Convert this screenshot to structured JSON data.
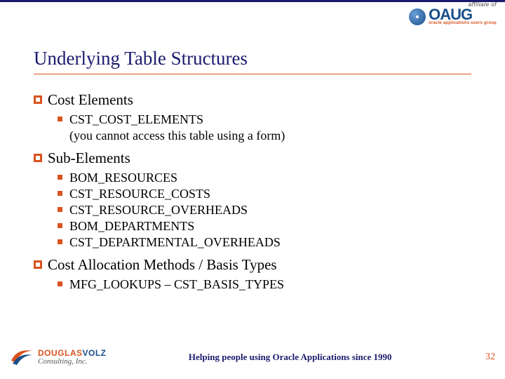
{
  "header": {
    "affiliate_label": "affiliate of",
    "oaug": "OAUG",
    "oaug_sub": "oracle applications users group"
  },
  "title": "Underlying Table Structures",
  "sections": [
    {
      "heading": "Cost Elements",
      "items": [
        {
          "text": "CST_COST_ELEMENTS",
          "paren": "(you cannot access this table using a form)"
        }
      ]
    },
    {
      "heading": "Sub-Elements",
      "items": [
        {
          "text": "BOM_RESOURCES"
        },
        {
          "text": "CST_RESOURCE_COSTS"
        },
        {
          "text": "CST_RESOURCE_OVERHEADS"
        },
        {
          "text": "BOM_DEPARTMENTS"
        },
        {
          "text": "CST_DEPARTMENTAL_OVERHEADS"
        }
      ]
    },
    {
      "heading": "Cost Allocation Methods / Basis Types",
      "items": [
        {
          "text": "MFG_LOOKUPS – CST_BASIS_TYPES"
        }
      ]
    }
  ],
  "footer": {
    "logo_top_a": "DOUGLAS",
    "logo_top_b": "VOLZ",
    "logo_sub": "Consulting, Inc.",
    "tagline": "Helping people using Oracle Applications since 1990",
    "page": "32"
  }
}
